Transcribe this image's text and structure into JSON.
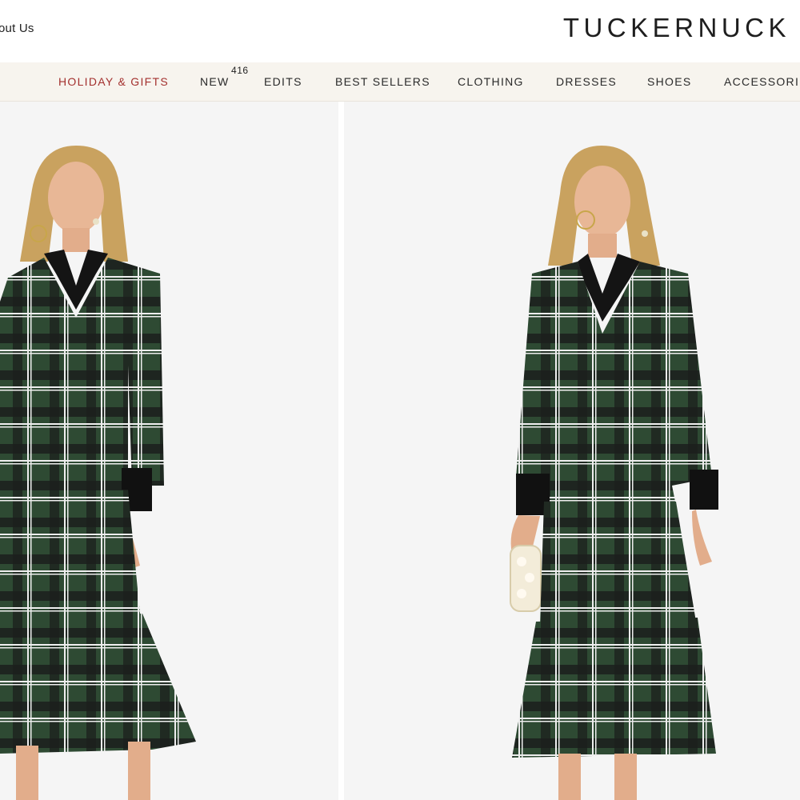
{
  "header": {
    "about_link": "out Us",
    "brand": "TUCKERNUCK"
  },
  "nav": {
    "items": [
      {
        "label": "HOLIDAY & GIFTS"
      },
      {
        "label": "NEW",
        "badge": "416"
      },
      {
        "label": "EDITS"
      },
      {
        "label": "BEST SELLERS"
      },
      {
        "label": "CLOTHING"
      },
      {
        "label": "DRESSES"
      },
      {
        "label": "SHOES"
      },
      {
        "label": "ACCESSORIE"
      }
    ]
  },
  "gallery": {
    "images": [
      {
        "subject": "model in green plaid tiered maxi dress, front view"
      },
      {
        "subject": "model in green plaid tiered maxi dress holding pearl clutch"
      }
    ]
  },
  "colors": {
    "holiday_accent": "#a3302e",
    "nav_background": "#f7f4ee",
    "plaid_green": "#2e4a33",
    "plaid_black": "#1b1f1c"
  }
}
